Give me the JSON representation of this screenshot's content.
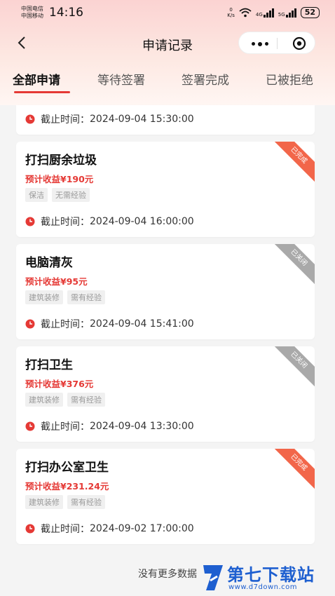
{
  "status_bar": {
    "carrier1": "中国电信",
    "carrier2": "中国移动",
    "time": "14:16",
    "net_speed_value": "0",
    "net_speed_unit": "K/s",
    "sig1_label": "4G",
    "sig2_label": "5G",
    "battery": "52"
  },
  "nav": {
    "title": "申请记录"
  },
  "tabs": [
    {
      "label": "全部申请"
    },
    {
      "label": "等待签署"
    },
    {
      "label": "签署完成"
    },
    {
      "label": "已被拒绝"
    }
  ],
  "cards": [
    {
      "deadline_label": "截止时间：",
      "deadline": "2024-09-04 15:30:00"
    },
    {
      "title": "打扫厨余垃圾",
      "income": "预计收益¥190元",
      "tags": [
        "保洁",
        "无需经验"
      ],
      "deadline_label": "截止时间：",
      "deadline": "2024-09-04 16:00:00",
      "status": "已完成"
    },
    {
      "title": "电脑清灰",
      "income": "预计收益¥95元",
      "tags": [
        "建筑装修",
        "需有经验"
      ],
      "deadline_label": "截止时间：",
      "deadline": "2024-09-04 15:41:00",
      "status": "已关闭"
    },
    {
      "title": "打扫卫生",
      "income": "预计收益¥376元",
      "tags": [
        "建筑装修",
        "需有经验"
      ],
      "deadline_label": "截止时间：",
      "deadline": "2024-09-04 13:30:00",
      "status": "已关闭"
    },
    {
      "title": "打扫办公室卫生",
      "income": "预计收益¥231.24元",
      "tags": [
        "建筑装修",
        "需有经验"
      ],
      "deadline_label": "截止时间：",
      "deadline": "2024-09-02 17:00:00",
      "status": "已完成"
    }
  ],
  "footer": {
    "text": "没有更多数据"
  },
  "watermark": {
    "title": "第七下载站",
    "url": "www.d7down.com"
  },
  "colors": {
    "accent": "#e53935",
    "ribbon_done": "#f2664a",
    "ribbon_closed": "#a9a9a9",
    "watermark": "#1e5fd0"
  }
}
